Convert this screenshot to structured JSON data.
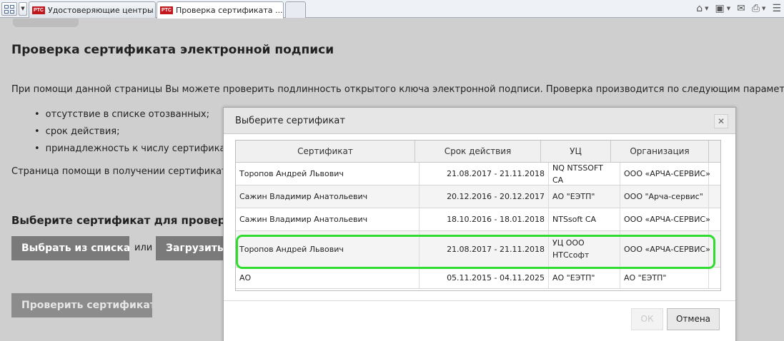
{
  "browser": {
    "tabs": [
      {
        "icon": "РТС",
        "title": "Удостоверяющие центры ..."
      },
      {
        "icon": "РТС",
        "title": "Проверка сертификата ..."
      }
    ],
    "close_glyph": "✕",
    "toolbar_icons": [
      "home-icon",
      "rss-feed-icon",
      "read-mail-icon",
      "print-icon",
      "page-menu-icon"
    ]
  },
  "page": {
    "title": "Проверка сертификата электронной подписи",
    "intro": "При помощи данной страницы Вы можете проверить подлинность открытого ключа электронной подписи. Проверка производится по следующим параметрам:",
    "params": [
      "отсутствие в списке отозванных;",
      "срок действия;",
      "принадлежность к числу сертификато"
    ],
    "help": "Страница помощи в получении сертификата у",
    "choose_heading": "Выберите сертификат для проверки",
    "pick_button": "Выбрать из списка",
    "or": "или",
    "upload_button": "Загрузить ф",
    "verify_button": "Проверить сертификат"
  },
  "dialog": {
    "title": "Выберите сертификат",
    "close": "✕",
    "columns": [
      "Сертификат",
      "Срок действия",
      "УЦ",
      "Организация"
    ],
    "rows": [
      {
        "cert": "Торопов Андрей Львович",
        "validity": "21.08.2017 - 21.11.2018",
        "ca": "NQ NTSSOFT CA",
        "org": "ООО «АРЧА-СЕРВИС»"
      },
      {
        "cert": "Сажин Владимир Анатольевич",
        "validity": "20.12.2016 - 20.12.2017",
        "ca": "АО \"ЕЭТП\"",
        "org": "ООО \"Арча-сервис\""
      },
      {
        "cert": "Сажин Владимир Анатольевич",
        "validity": "18.10.2016 - 18.01.2018",
        "ca": "NTSsoft CA",
        "org": "ООО «АРЧА-СЕРВИС»"
      },
      {
        "cert": "Торопов Андрей Львович",
        "validity": "21.08.2017 - 21.11.2018",
        "ca": "УЦ ООО НТСсофт",
        "org": "ООО «АРЧА-СЕРВИС»"
      },
      {
        "cert": "АО",
        "validity": "05.11.2015 - 04.11.2025",
        "ca": "АО \"ЕЭТП\"",
        "org": "АО \"ЕЭТП\""
      }
    ],
    "ok": "ОК",
    "cancel": "Отмена",
    "highlight_color": "#2fdc2f"
  }
}
